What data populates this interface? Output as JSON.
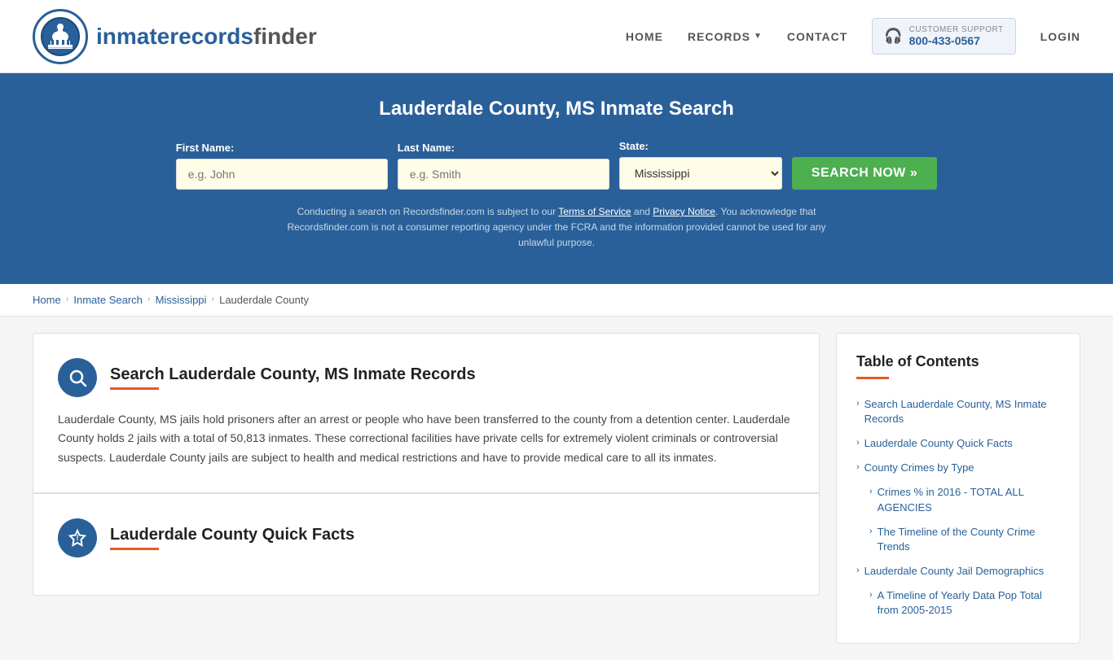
{
  "header": {
    "logo_text_inmate": "inmate",
    "logo_text_records": "records",
    "logo_text_finder": "finder",
    "nav": {
      "home": "HOME",
      "records": "RECORDS",
      "contact": "CONTACT",
      "support_label": "CUSTOMER SUPPORT",
      "support_number": "800-433-0567",
      "login": "LOGIN"
    }
  },
  "hero": {
    "title": "Lauderdale County, MS Inmate Search",
    "first_name_label": "First Name:",
    "first_name_placeholder": "e.g. John",
    "last_name_label": "Last Name:",
    "last_name_placeholder": "e.g. Smith",
    "state_label": "State:",
    "state_value": "Mississippi",
    "search_button": "SEARCH NOW »",
    "disclaimer": "Conducting a search on Recordsfinder.com is subject to our Terms of Service and Privacy Notice. You acknowledge that Recordsfinder.com is not a consumer reporting agency under the FCRA and the information provided cannot be used for any unlawful purpose.",
    "terms_link": "Terms of Service",
    "privacy_link": "Privacy Notice"
  },
  "breadcrumb": {
    "home": "Home",
    "inmate_search": "Inmate Search",
    "state": "Mississippi",
    "county": "Lauderdale County"
  },
  "main_section": {
    "search_section": {
      "title": "Search Lauderdale County, MS Inmate Records",
      "body": "Lauderdale County, MS jails hold prisoners after an arrest or people who have been transferred to the county from a detention center. Lauderdale County holds 2 jails with a total of 50,813 inmates. These correctional facilities have private cells for extremely violent criminals or controversial suspects. Lauderdale County jails are subject to health and medical restrictions and have to provide medical care to all its inmates."
    },
    "quick_facts_section": {
      "title": "Lauderdale County Quick Facts"
    }
  },
  "toc": {
    "title": "Table of Contents",
    "items": [
      {
        "label": "Search Lauderdale County, MS Inmate Records",
        "sub": false
      },
      {
        "label": "Lauderdale County Quick Facts",
        "sub": false
      },
      {
        "label": "County Crimes by Type",
        "sub": false
      },
      {
        "label": "Crimes % in 2016 - TOTAL ALL AGENCIES",
        "sub": true
      },
      {
        "label": "The Timeline of the County Crime Trends",
        "sub": true
      },
      {
        "label": "Lauderdale County Jail Demographics",
        "sub": false
      },
      {
        "label": "A Timeline of Yearly Data Pop Total from 2005-2015",
        "sub": true
      }
    ]
  }
}
